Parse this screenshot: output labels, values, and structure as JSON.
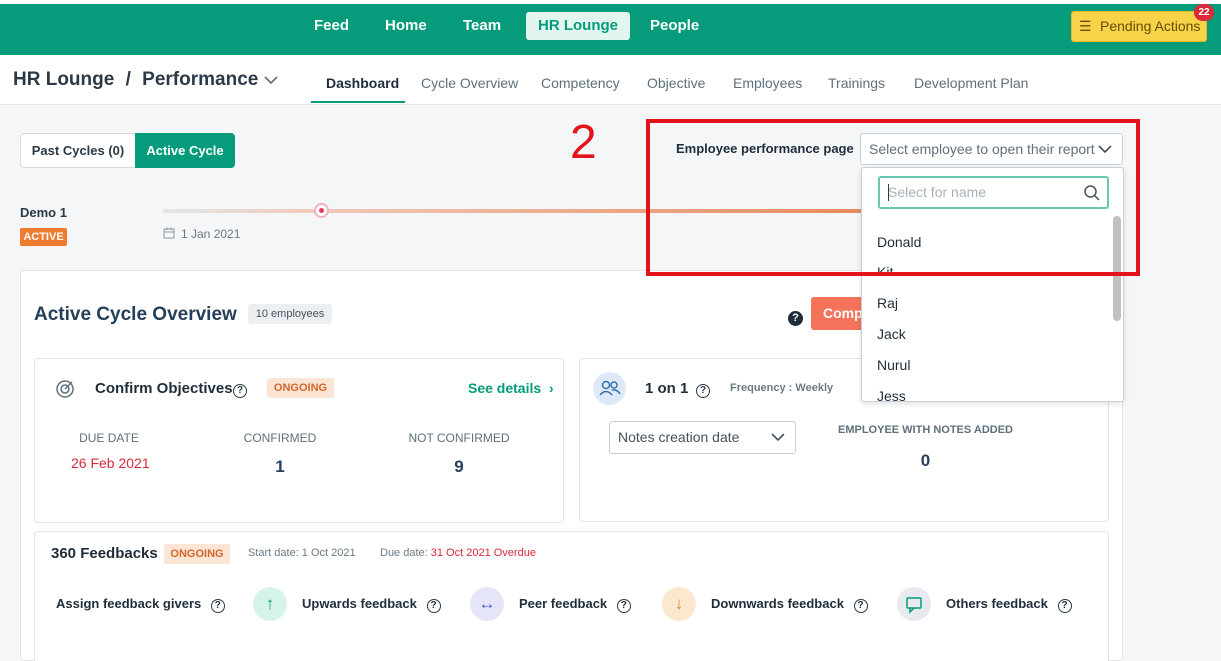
{
  "topnav": {
    "items": [
      "Feed",
      "Home",
      "Team",
      "HR Lounge",
      "People"
    ],
    "pending_label": "Pending Actions",
    "pending_count": "22",
    "accent": "#069b7b"
  },
  "breadcrumb": {
    "section": "HR Lounge",
    "separator": "/",
    "page": "Performance"
  },
  "subtabs": [
    "Dashboard",
    "Cycle Overview",
    "Competency",
    "Objective",
    "Employees",
    "Trainings",
    "Development Plan"
  ],
  "cycle_toggle": {
    "past": "Past Cycles (0)",
    "active": "Active Cycle"
  },
  "cycle": {
    "name": "Demo 1",
    "status": "ACTIVE",
    "start_date": "1 Jan 2021"
  },
  "annotation": {
    "number": "2"
  },
  "employee_report": {
    "label": "Employee performance page",
    "placeholder": "Select employee to open their report",
    "search_placeholder": "Select for name",
    "options": [
      "Donald",
      "Kit",
      "Raj",
      "Jack",
      "Nurul",
      "Jess"
    ]
  },
  "overview": {
    "title": "Active Cycle Overview",
    "employee_count": "10 employees",
    "complete_button": "Complete Cycle"
  },
  "confirm_objectives": {
    "title": "Confirm Objectives",
    "status": "ONGOING",
    "see_details": "See details",
    "due_date_label": "DUE DATE",
    "due_date": "26 Feb 2021",
    "confirmed_label": "CONFIRMED",
    "confirmed": "1",
    "not_confirmed_label": "NOT CONFIRMED",
    "not_confirmed": "9"
  },
  "one_on_one": {
    "title": "1 on 1",
    "frequency": "Frequency : Weekly",
    "notes_select": "Notes creation date",
    "notes_label": "EMPLOYEE WITH NOTES ADDED",
    "notes_count": "0"
  },
  "feedback": {
    "title": "360 Feedbacks",
    "status": "ONGOING",
    "start_date": "Start date: 1 Oct 2021",
    "due_label": "Due date:",
    "due_value": "31 Oct 2021 Overdue",
    "items": [
      "Assign feedback givers",
      "Upwards feedback",
      "Peer feedback",
      "Downwards feedback",
      "Others feedback"
    ]
  }
}
